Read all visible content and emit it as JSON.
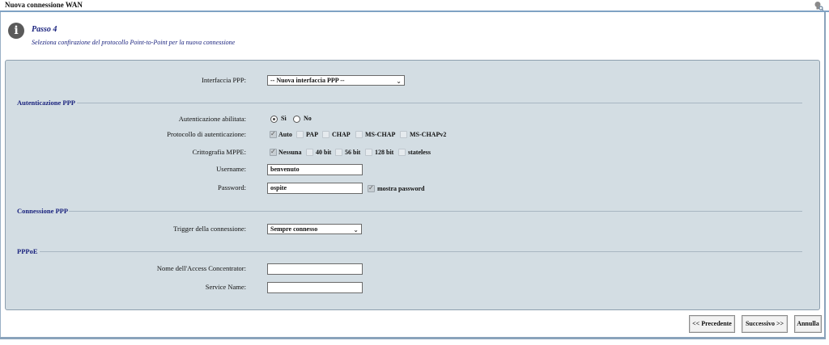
{
  "window": {
    "title": "Nuova connessione WAN",
    "help_icon": "help-search-icon"
  },
  "step": {
    "title": "Passo 4",
    "description": "Seleziona confirazione del protocollo Point-to-Point per la nuova connessione",
    "icon": "info-icon"
  },
  "ppp_interface": {
    "label": "Interfaccia PPP:",
    "selected": "-- Nuova interfaccia PPP --"
  },
  "auth_section": {
    "title": "Autenticazione PPP",
    "enabled_label": "Autenticazione abilitata:",
    "enabled_options": [
      {
        "label": "Sì",
        "checked": true
      },
      {
        "label": "No",
        "checked": false
      }
    ],
    "protocol_label": "Protocollo di autenticazione:",
    "protocols": [
      {
        "label": "Auto",
        "checked": true
      },
      {
        "label": "PAP",
        "checked": false
      },
      {
        "label": "CHAP",
        "checked": false
      },
      {
        "label": "MS-CHAP",
        "checked": false
      },
      {
        "label": "MS-CHAPv2",
        "checked": false
      }
    ],
    "mppe_label": "Crittografia MPPE:",
    "mppe": [
      {
        "label": "Nessuna",
        "checked": true
      },
      {
        "label": "40 bit",
        "checked": false
      },
      {
        "label": "56 bit",
        "checked": false
      },
      {
        "label": "128 bit",
        "checked": false
      },
      {
        "label": "stateless",
        "checked": false
      }
    ],
    "username_label": "Username:",
    "username_value": "benvenuto",
    "password_label": "Password:",
    "password_value": "ospite",
    "show_password_label": "mostra password",
    "show_password_checked": true
  },
  "connection_section": {
    "title": "Connessione PPP",
    "trigger_label": "Trigger della connessione:",
    "trigger_selected": "Sempre connesso"
  },
  "pppoe_section": {
    "title": "PPPoE",
    "ac_name_label": "Nome dell'Access Concentrator:",
    "ac_name_value": "",
    "service_name_label": "Service Name:",
    "service_name_value": ""
  },
  "buttons": {
    "previous": "<< Precedente",
    "next": "Successivo >>",
    "cancel": "Annulla"
  }
}
